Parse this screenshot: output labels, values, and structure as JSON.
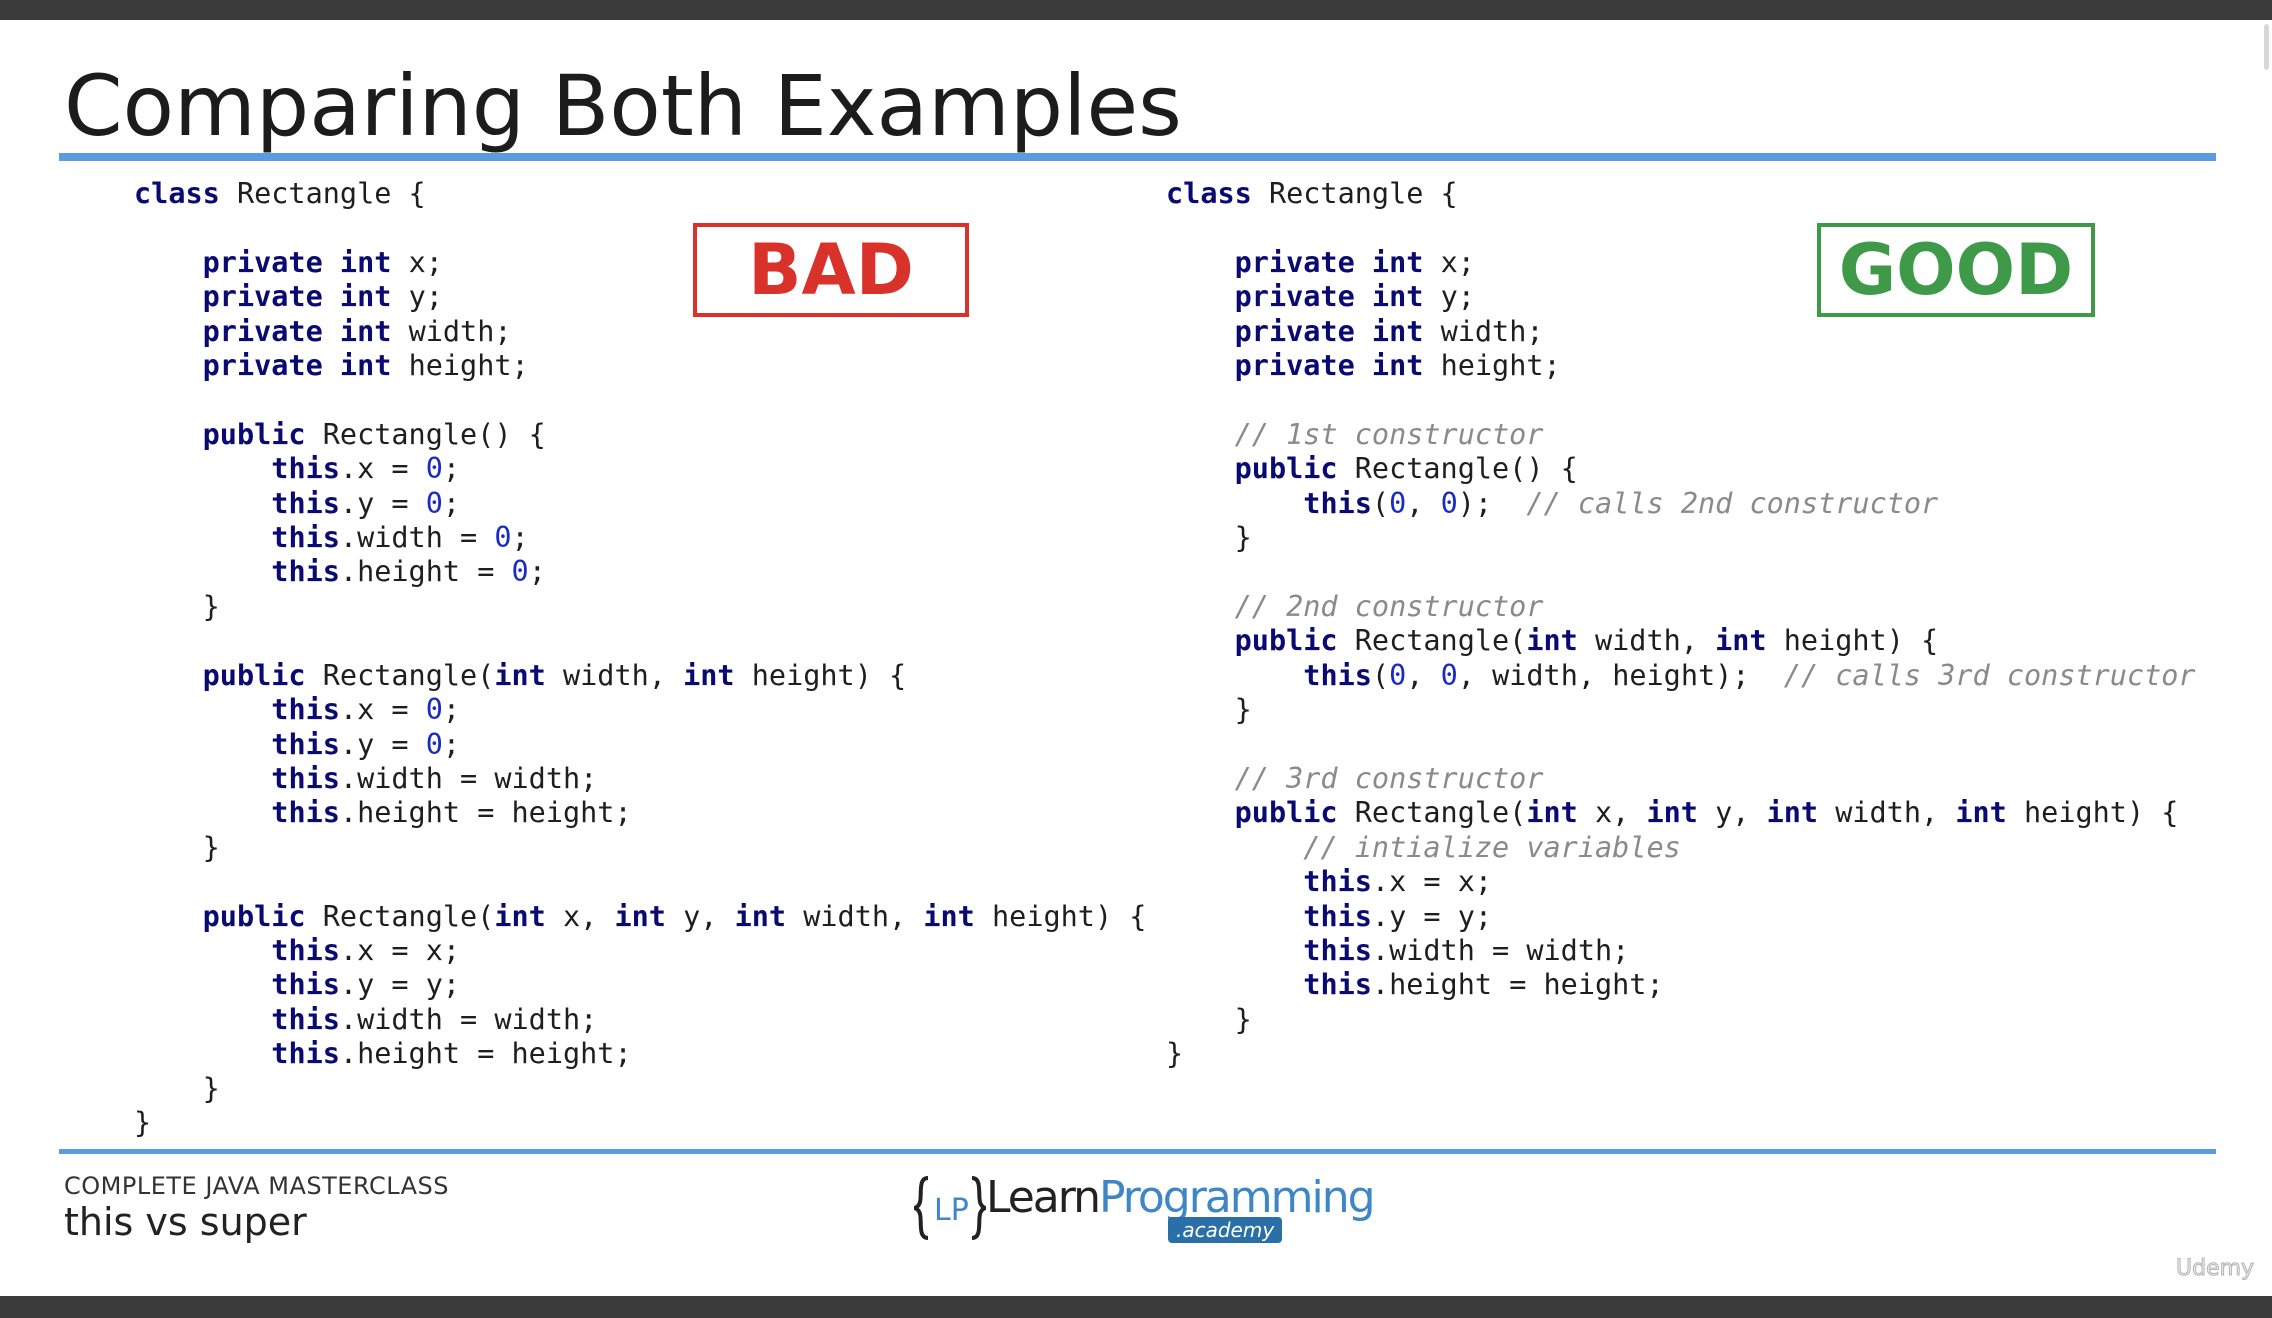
{
  "slide": {
    "title": "Comparing Both Examples",
    "badges": {
      "bad": "BAD",
      "good": "GOOD"
    },
    "badge_colors": {
      "bad": "#d9322a",
      "good": "#3e9a49"
    },
    "accent_color": "#5b9cdf"
  },
  "code": {
    "left": [
      [
        {
          "t": "class",
          "k": "kw"
        },
        {
          "t": " Rectangle {"
        }
      ],
      [],
      [
        {
          "t": "    "
        },
        {
          "t": "private",
          "k": "kw"
        },
        {
          "t": " "
        },
        {
          "t": "int",
          "k": "kw"
        },
        {
          "t": " x;"
        }
      ],
      [
        {
          "t": "    "
        },
        {
          "t": "private",
          "k": "kw"
        },
        {
          "t": " "
        },
        {
          "t": "int",
          "k": "kw"
        },
        {
          "t": " y;"
        }
      ],
      [
        {
          "t": "    "
        },
        {
          "t": "private",
          "k": "kw"
        },
        {
          "t": " "
        },
        {
          "t": "int",
          "k": "kw"
        },
        {
          "t": " width;"
        }
      ],
      [
        {
          "t": "    "
        },
        {
          "t": "private",
          "k": "kw"
        },
        {
          "t": " "
        },
        {
          "t": "int",
          "k": "kw"
        },
        {
          "t": " height;"
        }
      ],
      [],
      [
        {
          "t": "    "
        },
        {
          "t": "public",
          "k": "kw"
        },
        {
          "t": " Rectangle() {"
        }
      ],
      [
        {
          "t": "        "
        },
        {
          "t": "this",
          "k": "kw"
        },
        {
          "t": ".x = "
        },
        {
          "t": "0",
          "k": "num"
        },
        {
          "t": ";"
        }
      ],
      [
        {
          "t": "        "
        },
        {
          "t": "this",
          "k": "kw"
        },
        {
          "t": ".y = "
        },
        {
          "t": "0",
          "k": "num"
        },
        {
          "t": ";"
        }
      ],
      [
        {
          "t": "        "
        },
        {
          "t": "this",
          "k": "kw"
        },
        {
          "t": ".width = "
        },
        {
          "t": "0",
          "k": "num"
        },
        {
          "t": ";"
        }
      ],
      [
        {
          "t": "        "
        },
        {
          "t": "this",
          "k": "kw"
        },
        {
          "t": ".height = "
        },
        {
          "t": "0",
          "k": "num"
        },
        {
          "t": ";"
        }
      ],
      [
        {
          "t": "    }"
        }
      ],
      [],
      [
        {
          "t": "    "
        },
        {
          "t": "public",
          "k": "kw"
        },
        {
          "t": " Rectangle("
        },
        {
          "t": "int",
          "k": "kw"
        },
        {
          "t": " width, "
        },
        {
          "t": "int",
          "k": "kw"
        },
        {
          "t": " height) {"
        }
      ],
      [
        {
          "t": "        "
        },
        {
          "t": "this",
          "k": "kw"
        },
        {
          "t": ".x = "
        },
        {
          "t": "0",
          "k": "num"
        },
        {
          "t": ";"
        }
      ],
      [
        {
          "t": "        "
        },
        {
          "t": "this",
          "k": "kw"
        },
        {
          "t": ".y = "
        },
        {
          "t": "0",
          "k": "num"
        },
        {
          "t": ";"
        }
      ],
      [
        {
          "t": "        "
        },
        {
          "t": "this",
          "k": "kw"
        },
        {
          "t": ".width = width;"
        }
      ],
      [
        {
          "t": "        "
        },
        {
          "t": "this",
          "k": "kw"
        },
        {
          "t": ".height = height;"
        }
      ],
      [
        {
          "t": "    }"
        }
      ],
      [],
      [
        {
          "t": "    "
        },
        {
          "t": "public",
          "k": "kw"
        },
        {
          "t": " Rectangle("
        },
        {
          "t": "int",
          "k": "kw"
        },
        {
          "t": " x, "
        },
        {
          "t": "int",
          "k": "kw"
        },
        {
          "t": " y, "
        },
        {
          "t": "int",
          "k": "kw"
        },
        {
          "t": " width, "
        },
        {
          "t": "int",
          "k": "kw"
        },
        {
          "t": " height) {"
        }
      ],
      [
        {
          "t": "        "
        },
        {
          "t": "this",
          "k": "kw"
        },
        {
          "t": ".x = x;"
        }
      ],
      [
        {
          "t": "        "
        },
        {
          "t": "this",
          "k": "kw"
        },
        {
          "t": ".y = y;"
        }
      ],
      [
        {
          "t": "        "
        },
        {
          "t": "this",
          "k": "kw"
        },
        {
          "t": ".width = width;"
        }
      ],
      [
        {
          "t": "        "
        },
        {
          "t": "this",
          "k": "kw"
        },
        {
          "t": ".height = height;"
        }
      ],
      [
        {
          "t": "    }"
        }
      ],
      [
        {
          "t": "}"
        }
      ]
    ],
    "right": [
      [
        {
          "t": "class",
          "k": "kw"
        },
        {
          "t": " Rectangle {"
        }
      ],
      [],
      [
        {
          "t": "    "
        },
        {
          "t": "private",
          "k": "kw"
        },
        {
          "t": " "
        },
        {
          "t": "int",
          "k": "kw"
        },
        {
          "t": " x;"
        }
      ],
      [
        {
          "t": "    "
        },
        {
          "t": "private",
          "k": "kw"
        },
        {
          "t": " "
        },
        {
          "t": "int",
          "k": "kw"
        },
        {
          "t": " y;"
        }
      ],
      [
        {
          "t": "    "
        },
        {
          "t": "private",
          "k": "kw"
        },
        {
          "t": " "
        },
        {
          "t": "int",
          "k": "kw"
        },
        {
          "t": " width;"
        }
      ],
      [
        {
          "t": "    "
        },
        {
          "t": "private",
          "k": "kw"
        },
        {
          "t": " "
        },
        {
          "t": "int",
          "k": "kw"
        },
        {
          "t": " height;"
        }
      ],
      [],
      [
        {
          "t": "    "
        },
        {
          "t": "// 1st constructor",
          "k": "cm"
        }
      ],
      [
        {
          "t": "    "
        },
        {
          "t": "public",
          "k": "kw"
        },
        {
          "t": " Rectangle() {"
        }
      ],
      [
        {
          "t": "        "
        },
        {
          "t": "this",
          "k": "kw"
        },
        {
          "t": "("
        },
        {
          "t": "0",
          "k": "num"
        },
        {
          "t": ", "
        },
        {
          "t": "0",
          "k": "num"
        },
        {
          "t": ");  "
        },
        {
          "t": "// calls 2nd constructor",
          "k": "cm"
        }
      ],
      [
        {
          "t": "    }"
        }
      ],
      [],
      [
        {
          "t": "    "
        },
        {
          "t": "// 2nd constructor",
          "k": "cm"
        }
      ],
      [
        {
          "t": "    "
        },
        {
          "t": "public",
          "k": "kw"
        },
        {
          "t": " Rectangle("
        },
        {
          "t": "int",
          "k": "kw"
        },
        {
          "t": " width, "
        },
        {
          "t": "int",
          "k": "kw"
        },
        {
          "t": " height) {"
        }
      ],
      [
        {
          "t": "        "
        },
        {
          "t": "this",
          "k": "kw"
        },
        {
          "t": "("
        },
        {
          "t": "0",
          "k": "num"
        },
        {
          "t": ", "
        },
        {
          "t": "0",
          "k": "num"
        },
        {
          "t": ", width, height);  "
        },
        {
          "t": "// calls 3rd constructor",
          "k": "cm"
        }
      ],
      [
        {
          "t": "    }"
        }
      ],
      [],
      [
        {
          "t": "    "
        },
        {
          "t": "// 3rd constructor",
          "k": "cm"
        }
      ],
      [
        {
          "t": "    "
        },
        {
          "t": "public",
          "k": "kw"
        },
        {
          "t": " Rectangle("
        },
        {
          "t": "int",
          "k": "kw"
        },
        {
          "t": " x, "
        },
        {
          "t": "int",
          "k": "kw"
        },
        {
          "t": " y, "
        },
        {
          "t": "int",
          "k": "kw"
        },
        {
          "t": " width, "
        },
        {
          "t": "int",
          "k": "kw"
        },
        {
          "t": " height) {"
        }
      ],
      [
        {
          "t": "        "
        },
        {
          "t": "// intialize variables",
          "k": "cm"
        }
      ],
      [
        {
          "t": "        "
        },
        {
          "t": "this",
          "k": "kw"
        },
        {
          "t": ".x = x;"
        }
      ],
      [
        {
          "t": "        "
        },
        {
          "t": "this",
          "k": "kw"
        },
        {
          "t": ".y = y;"
        }
      ],
      [
        {
          "t": "        "
        },
        {
          "t": "this",
          "k": "kw"
        },
        {
          "t": ".width = width;"
        }
      ],
      [
        {
          "t": "        "
        },
        {
          "t": "this",
          "k": "kw"
        },
        {
          "t": ".height = height;"
        }
      ],
      [
        {
          "t": "    }"
        }
      ],
      [
        {
          "t": "}"
        }
      ]
    ]
  },
  "footer": {
    "course": "COMPLETE JAVA MASTERCLASS",
    "lesson": "this vs super",
    "logo": {
      "brace_text": "{LP}",
      "learn": "Learn",
      "programming": "Programming",
      "sub": ".academy"
    },
    "watermark": "Udemy"
  }
}
